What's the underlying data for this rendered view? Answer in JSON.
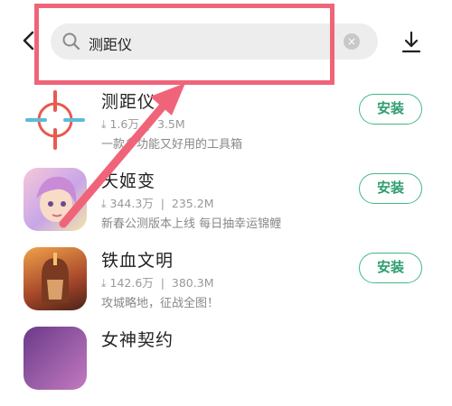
{
  "search": {
    "query": "测距仪",
    "clear_label": "×"
  },
  "apps": [
    {
      "name": "测距仪",
      "downloads": "1.6万",
      "size": "3.5M",
      "desc": "一款多功能又好用的工具箱",
      "action": "安装"
    },
    {
      "name": "天姬变",
      "downloads": "344.3万",
      "size": "235.2M",
      "desc": "新春公测版本上线 每日抽幸运锦鲤",
      "action": "安装"
    },
    {
      "name": "铁血文明",
      "downloads": "142.6万",
      "size": "380.3M",
      "desc": "攻城略地，征战全图！",
      "action": "安装"
    },
    {
      "name": "女神契约",
      "downloads": "",
      "size": "",
      "desc": "",
      "action": ""
    }
  ],
  "colors": {
    "accent": "#42b883",
    "highlight": "#f0647a",
    "icon_red": "#e85a4f",
    "search_bg": "#ededed"
  },
  "icons": {
    "back": "chevron-left-icon",
    "search": "search-icon",
    "clear": "close-icon",
    "download": "download-icon"
  }
}
